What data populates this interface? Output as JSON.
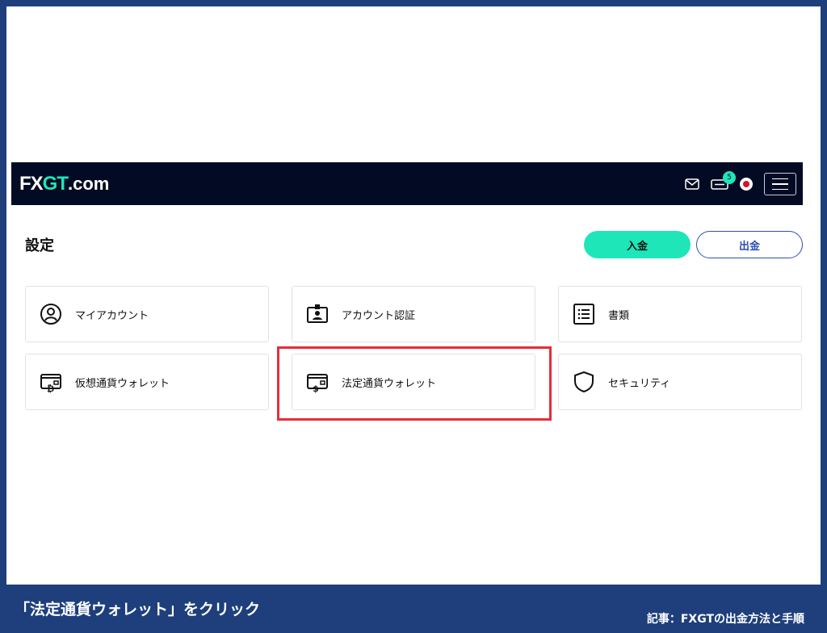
{
  "brand": {
    "logo_fx": "FX",
    "logo_gt": "GT",
    "logo_dotcom": ".com",
    "accent_color": "#1ee6b8",
    "header_bg": "#020b23"
  },
  "header": {
    "icons": [
      "mail-icon",
      "ticket-icon",
      "language-flag-icon",
      "hamburger-menu-icon"
    ],
    "notification_count": "5"
  },
  "settings": {
    "title": "設定",
    "deposit_label": "入金",
    "withdraw_label": "出金"
  },
  "cards": [
    {
      "label": "マイアカウント",
      "icon": "user-circle-icon"
    },
    {
      "label": "アカウント認証",
      "icon": "id-card-icon"
    },
    {
      "label": "書類",
      "icon": "document-list-icon"
    },
    {
      "label": "仮想通貨ウォレット",
      "icon": "crypto-wallet-icon"
    },
    {
      "label": "法定通貨ウォレット",
      "icon": "fiat-wallet-icon"
    },
    {
      "label": "セキュリティ",
      "icon": "shield-icon"
    }
  ],
  "annotation": {
    "highlight_color": "#e2303a",
    "highlighted_item": "法定通貨ウォレット"
  },
  "caption": {
    "instruction": "「法定通貨ウォレット」をクリック",
    "article": "記事：FXGTの出金方法と手順",
    "background": "#1e3f7c"
  }
}
